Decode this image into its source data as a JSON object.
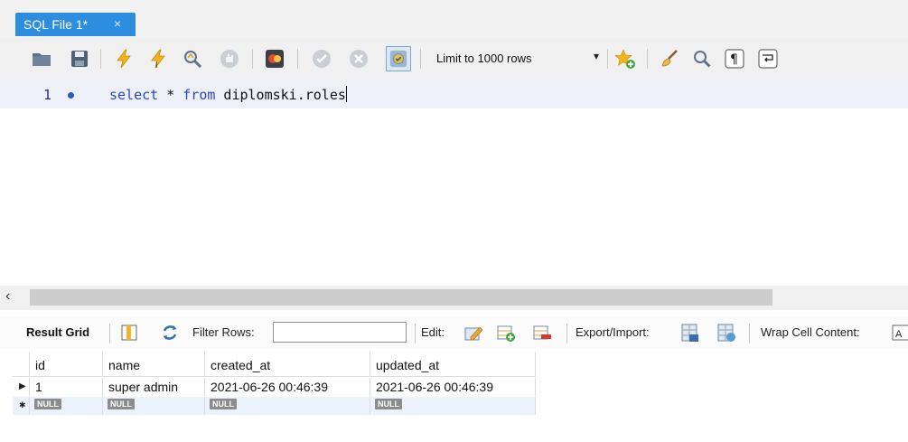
{
  "tab": {
    "title": "SQL File 1*",
    "close_glyph": "×"
  },
  "toolbar": {
    "limit_label": "Limit to 1000 rows",
    "limit_caret": "▾",
    "icons": [
      "open-folder-icon",
      "save-icon",
      "execute-lightning-icon",
      "execute-current-lightning-icon",
      "explain-magnifier-icon",
      "stop-hand-icon",
      "toggle-error-icon",
      "commit-check-icon",
      "rollback-x-icon",
      "auto-commit-toggle-icon",
      "add-snippet-star-icon",
      "beautify-broom-icon",
      "find-magnifier-icon",
      "invisible-chars-pilcrow-icon",
      "word-wrap-icon"
    ]
  },
  "editor": {
    "line_number": "1",
    "code": {
      "kw1": "select",
      "mid": " * ",
      "kw2": "from",
      "rest": " diplomski.roles"
    }
  },
  "scrollbar": {
    "left_arrow": "‹"
  },
  "result_toolbar": {
    "result_grid_label": "Result Grid",
    "filter_label": "Filter Rows:",
    "filter_value": "",
    "edit_label": "Edit:",
    "export_label": "Export/Import:",
    "wrap_label": "Wrap Cell Content:"
  },
  "grid": {
    "columns": [
      "id",
      "name",
      "created_at",
      "updated_at"
    ],
    "rows": [
      {
        "marker": "▶",
        "id": "1",
        "name": "super admin",
        "created_at": "2021-06-26 00:46:39",
        "updated_at": "2021-06-26 00:46:39"
      }
    ],
    "new_row": {
      "marker": "✱",
      "null_label": "NULL"
    }
  },
  "colors": {
    "tab_active": "#2d8ee0",
    "keyword": "#2b45c8",
    "current_line": "#eef0f7",
    "new_row": "#ebf2fb"
  }
}
